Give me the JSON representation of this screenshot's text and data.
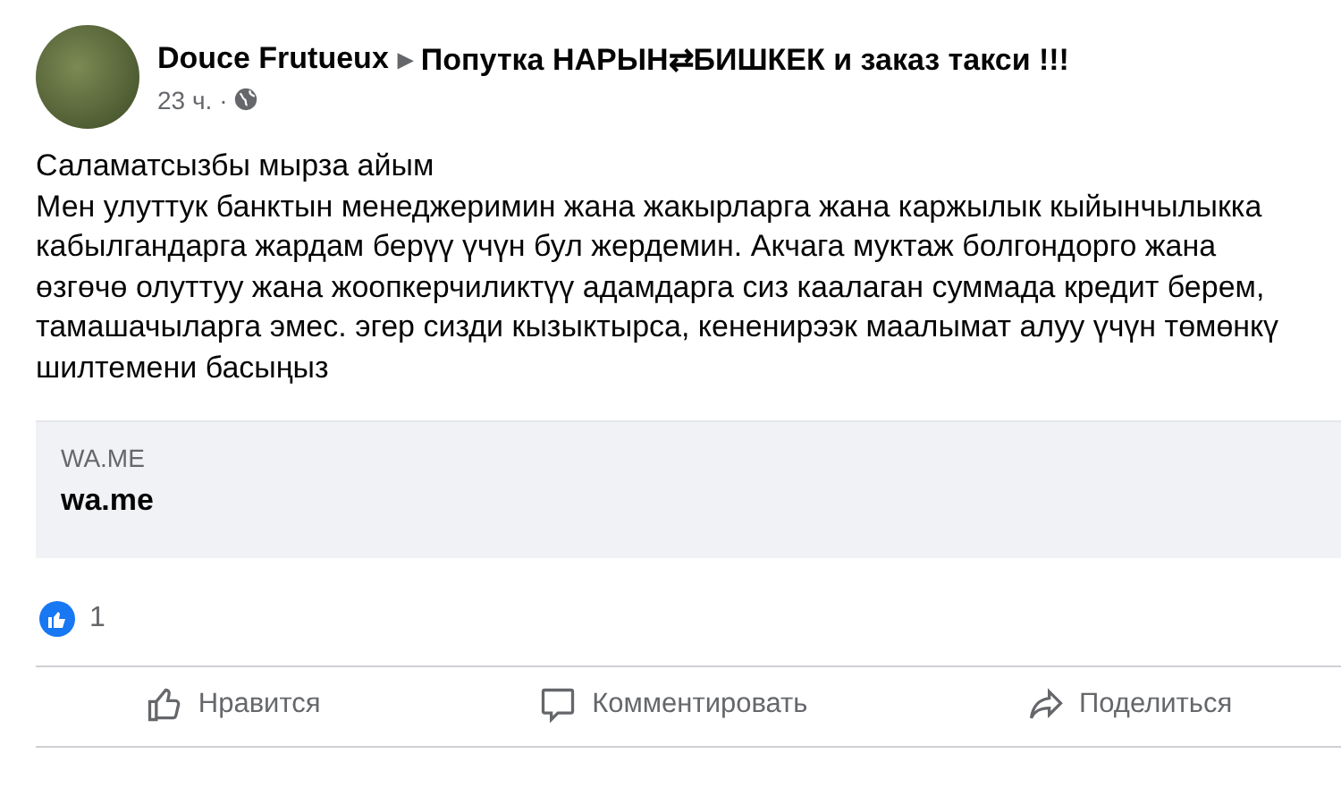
{
  "post": {
    "author": "Douce Frutueux",
    "arrow": "▶",
    "group": "Попутка НАРЫН⇄БИШКЕК и заказ такси !!!",
    "time": "23 ч.",
    "separator": "·",
    "greeting": "Саламатсызбы мырза айым",
    "body": "Мен улуттук банктын менеджеримин жана жакырларга жана каржылык кыйынчылыкка кабылгандарга жардам берүү үчүн бул жердемин. Акчага муктаж болгондорго жана өзгөчө олуттуу жана жоопкерчиликтүү адамдарга сиз каалаган суммада кредит берем, тамашачыларга эмес. эгер сизди кызыктырса, кененирээк маалымат алуу үчүн төмөнкү шилтемени басыңыз"
  },
  "link_preview": {
    "domain": "WA.ME",
    "title": "wa.me"
  },
  "reactions": {
    "count": "1"
  },
  "actions": [
    {
      "kind": "like",
      "label": "Нравится"
    },
    {
      "kind": "comment",
      "label": "Комментировать"
    },
    {
      "kind": "share",
      "label": "Поделиться"
    }
  ]
}
